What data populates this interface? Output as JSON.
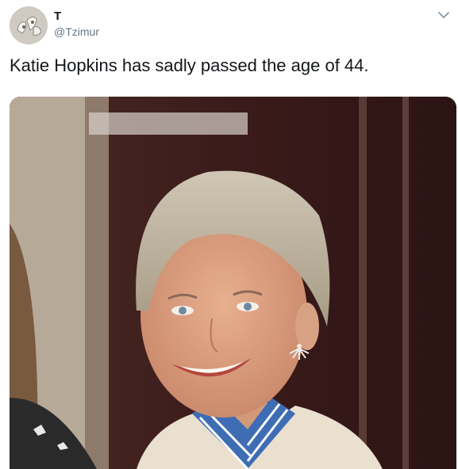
{
  "tweet": {
    "display_name": "T",
    "handle": "@Tzimur",
    "text": "Katie Hopkins has sadly passed the age of 44."
  },
  "icons": {
    "avatar": "avatar",
    "more": "chevron-down-icon"
  },
  "colors": {
    "text_primary": "#14171a",
    "text_secondary": "#657786",
    "caret": "#8899a6"
  }
}
